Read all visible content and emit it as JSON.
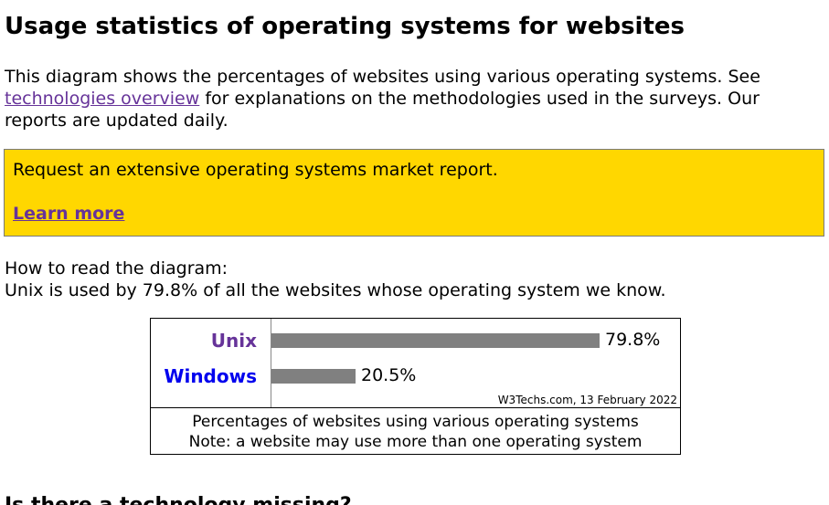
{
  "page": {
    "title": "Usage statistics of operating systems for websites"
  },
  "intro": {
    "text_before": "This diagram shows the percentages of websites using various operating systems. See ",
    "link_text": "technologies overview",
    "text_after": " for explanations on the methodologies used in the surveys. Our reports are updated daily."
  },
  "promo": {
    "text": "Request an extensive operating systems market report.",
    "link_text": "Learn more",
    "background_color": "#ffd700"
  },
  "howto": {
    "heading": "How to read the diagram:",
    "text": "Unix is used by 79.8% of all the websites whose operating system we know."
  },
  "chart_data": {
    "type": "bar",
    "orientation": "horizontal",
    "categories": [
      "Unix",
      "Windows"
    ],
    "values": [
      79.8,
      20.5
    ],
    "value_labels": [
      "79.8%",
      "20.5%"
    ],
    "category_colors": [
      "#663399",
      "#0000ee"
    ],
    "bar_color": "#808080",
    "xlim": [
      0,
      100
    ],
    "source": "W3Techs.com, 13 February 2022",
    "caption_line1": "Percentages of websites using various operating systems",
    "caption_line2": "Note: a website may use more than one operating system"
  },
  "next_section": {
    "heading": "Is there a technology missing?"
  }
}
